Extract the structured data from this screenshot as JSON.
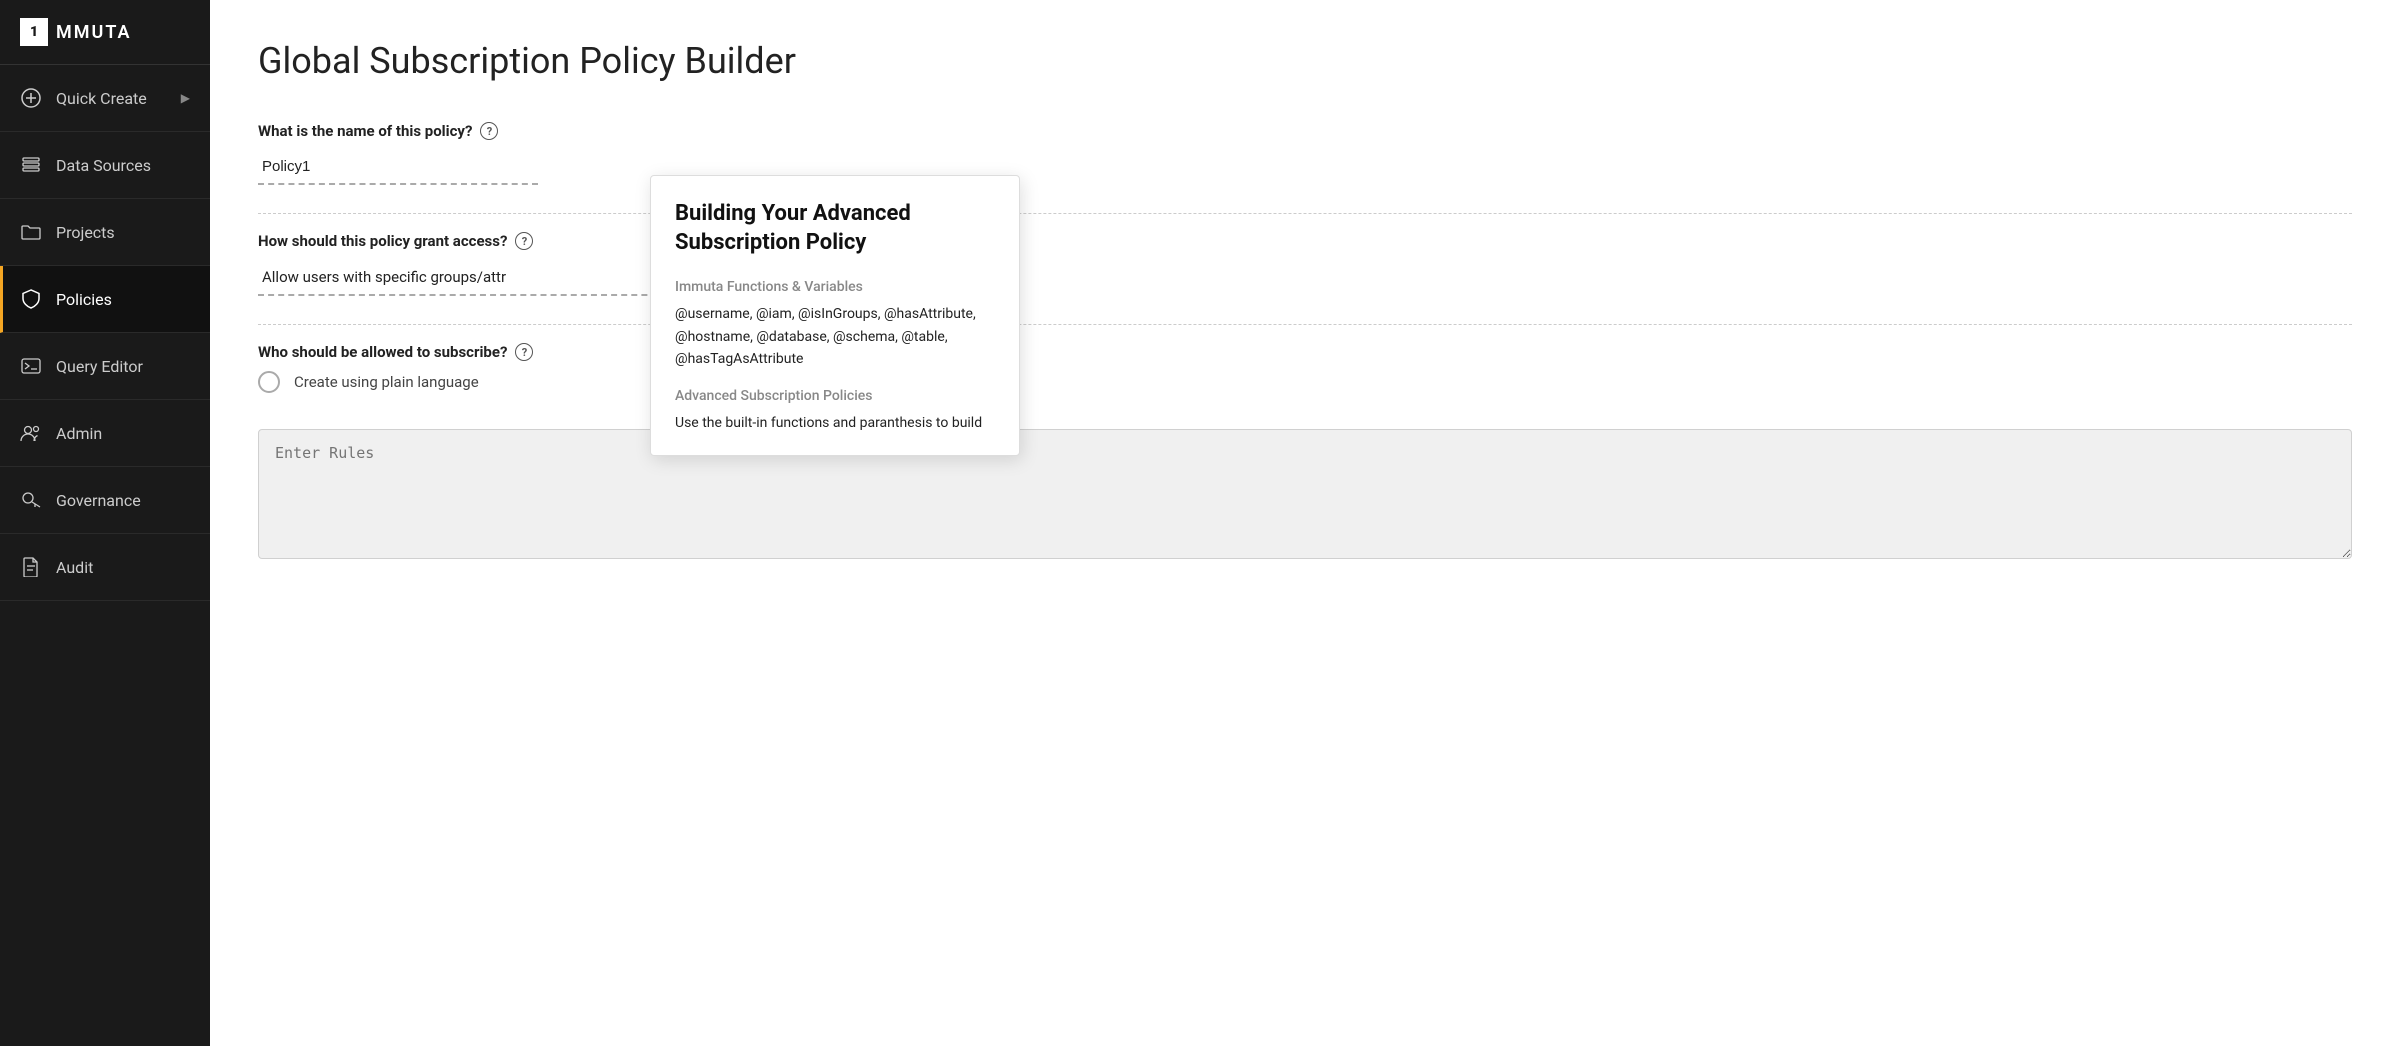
{
  "sidebar": {
    "logo_letter": "1",
    "logo_text": "MMUTA",
    "items": [
      {
        "id": "quick-create",
        "label": "Quick Create",
        "icon": "⊕",
        "has_arrow": true,
        "active": false
      },
      {
        "id": "data-sources",
        "label": "Data Sources",
        "icon": "layers",
        "has_arrow": false,
        "active": false
      },
      {
        "id": "projects",
        "label": "Projects",
        "icon": "folder",
        "has_arrow": false,
        "active": false
      },
      {
        "id": "policies",
        "label": "Policies",
        "icon": "shield",
        "has_arrow": false,
        "active": true
      },
      {
        "id": "query-editor",
        "label": "Query Editor",
        "icon": "terminal",
        "has_arrow": false,
        "active": false
      },
      {
        "id": "admin",
        "label": "Admin",
        "icon": "people",
        "has_arrow": false,
        "active": false
      },
      {
        "id": "governance",
        "label": "Governance",
        "icon": "key",
        "has_arrow": false,
        "active": false
      },
      {
        "id": "audit",
        "label": "Audit",
        "icon": "file",
        "has_arrow": false,
        "active": false
      }
    ]
  },
  "main": {
    "page_title": "Global Subscription Policy Builder",
    "name_label": "What is the name of this policy?",
    "name_value": "Policy1",
    "access_label": "How should this policy grant access?",
    "access_value": "Allow users with specific groups/attr",
    "subscribe_label": "Who should be allowed to subscribe?",
    "radio_label": "Create using plain language",
    "rules_placeholder": "Enter Rules"
  },
  "tooltip": {
    "title": "Building Your Advanced Subscription Policy",
    "section1_label": "Immuta Functions & Variables",
    "section1_text": "@username, @iam, @isInGroups, @hasAttribute, @hostname, @database, @schema, @table, @hasTagAsAttribute",
    "section2_label": "Advanced Subscription Policies",
    "section2_text": "Use the built-in functions and paranthesis to build"
  }
}
